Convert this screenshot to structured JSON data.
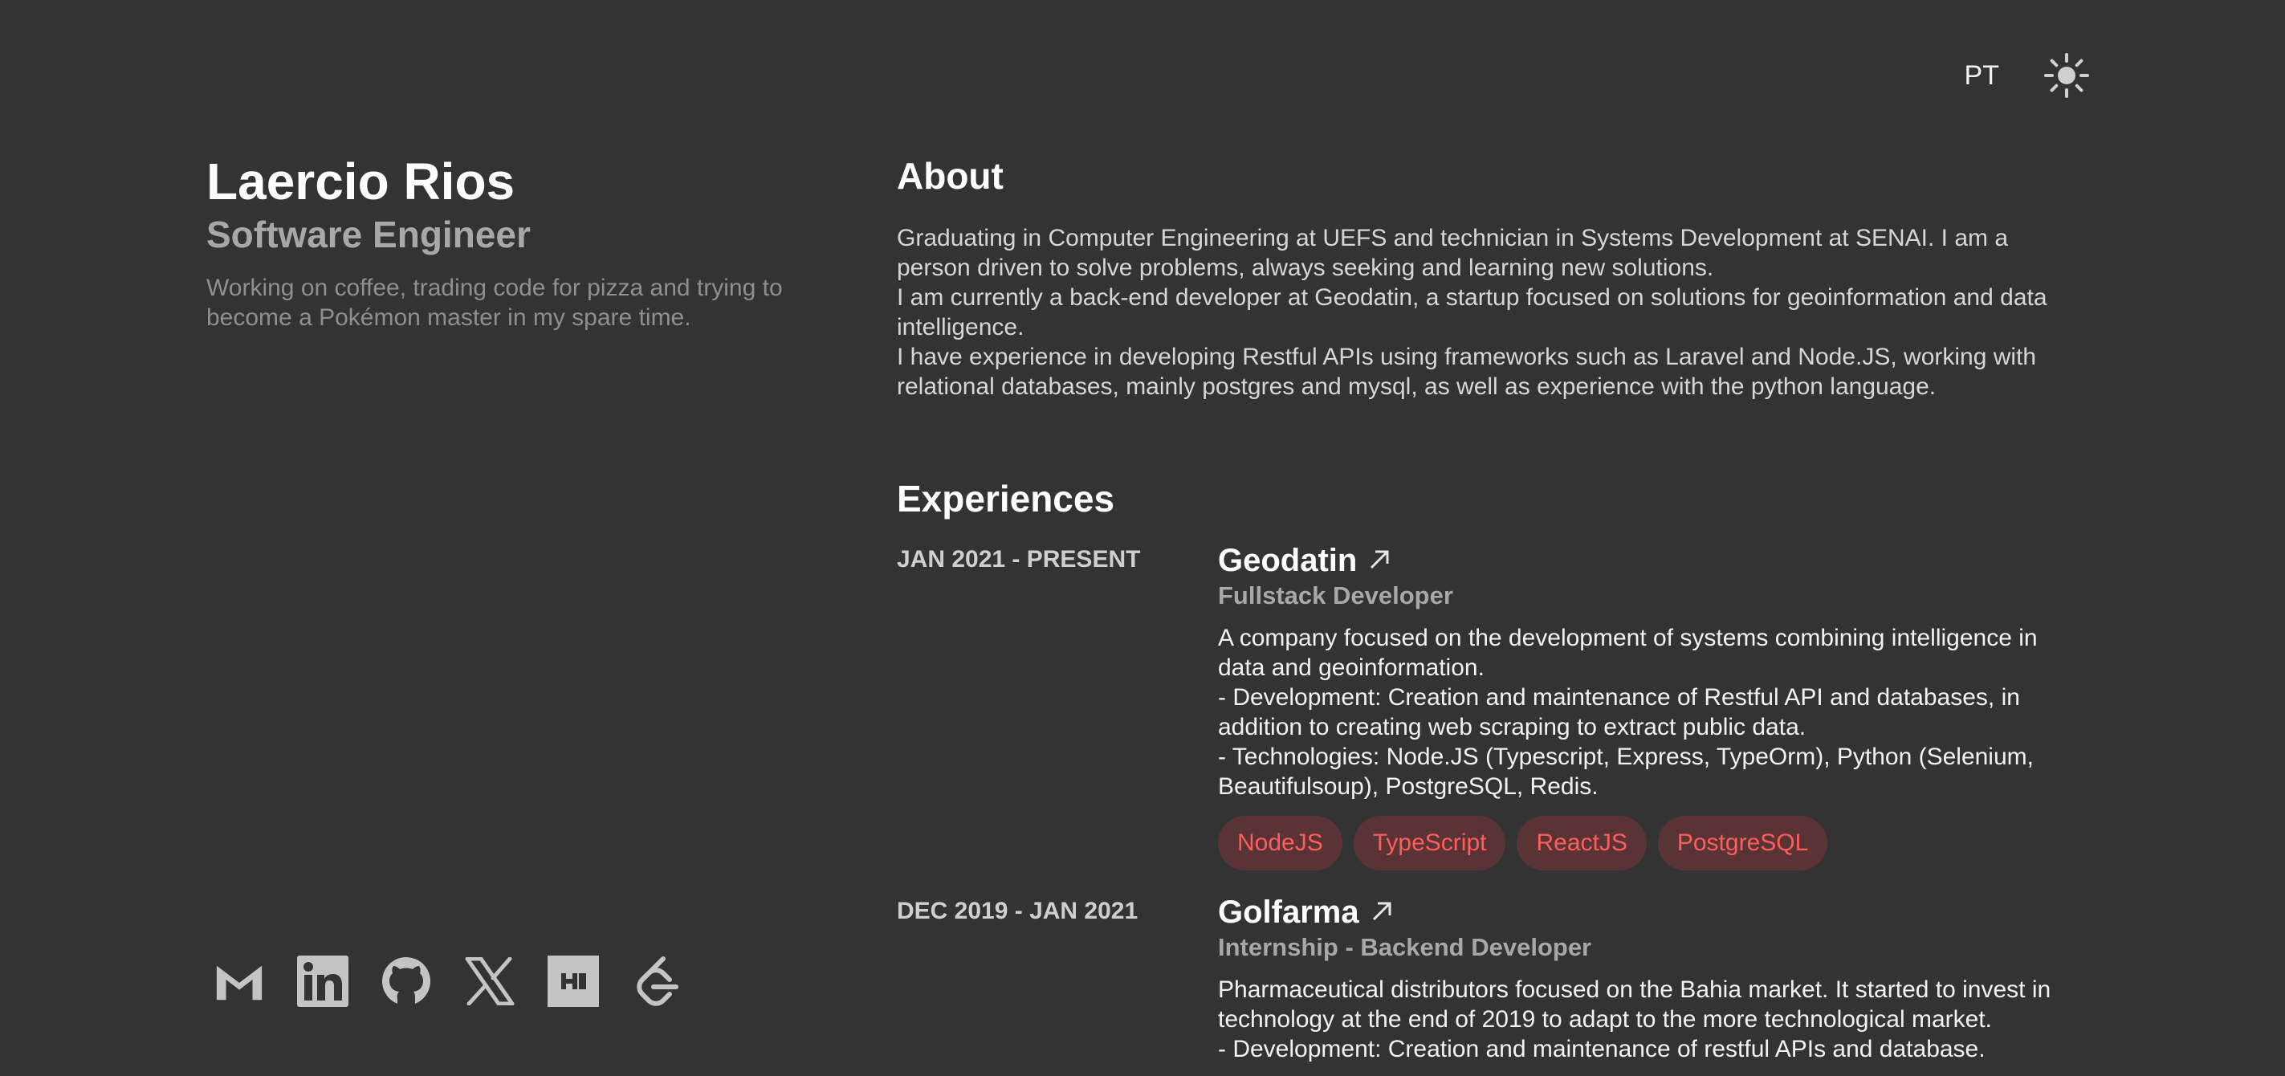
{
  "header": {
    "lang_label": "PT",
    "theme_icon": "sun-icon"
  },
  "profile": {
    "name": "Laercio Rios",
    "role": "Software Engineer",
    "tagline": "Working on coffee, trading code for pizza and trying to become a Pokémon master in my spare time."
  },
  "socials": [
    {
      "icon": "gmail-icon"
    },
    {
      "icon": "linkedin-icon"
    },
    {
      "icon": "github-icon"
    },
    {
      "icon": "x-icon"
    },
    {
      "icon": "hackerrank-icon"
    },
    {
      "icon": "leetcode-icon"
    }
  ],
  "about": {
    "title": "About",
    "paragraphs": [
      "Graduating in Computer Engineering at UEFS and technician in Systems Development at SENAI. I am a person driven to solve problems, always seeking and learning new solutions.",
      "I am currently a back-end developer at Geodatin, a startup focused on solutions for geoinformation and data intelligence.",
      "I have experience in developing Restful APIs using frameworks such as Laravel and Node.JS, working with relational databases, mainly postgres and mysql, as well as experience with the python language."
    ]
  },
  "experiences": {
    "title": "Experiences",
    "items": [
      {
        "date": "JAN 2021 - PRESENT",
        "company": "Geodatin",
        "position": "Fullstack Developer",
        "desc": [
          "A company focused on the development of systems combining intelligence in data and geoinformation.",
          "- Development: Creation and maintenance of Restful API and databases, in addition to creating web scraping to extract public data.",
          "- Technologies: Node.JS (Typescript, Express, TypeOrm), Python (Selenium, Beautifulsoup), PostgreSQL, Redis."
        ],
        "tags": [
          "NodeJS",
          "TypeScript",
          "ReactJS",
          "PostgreSQL"
        ]
      },
      {
        "date": "DEC 2019 - JAN 2021",
        "company": "Golfarma",
        "position": "Internship - Backend Developer",
        "desc": [
          "Pharmaceutical distributors focused on the Bahia market. It started to invest in technology at the end of 2019 to adapt to the more technological market.",
          "- Development: Creation and maintenance of restful APIs and database."
        ],
        "tags": []
      }
    ]
  },
  "colors": {
    "background": "#333333",
    "tag_bg": "#5a3434",
    "tag_text": "#ff5c5c"
  }
}
